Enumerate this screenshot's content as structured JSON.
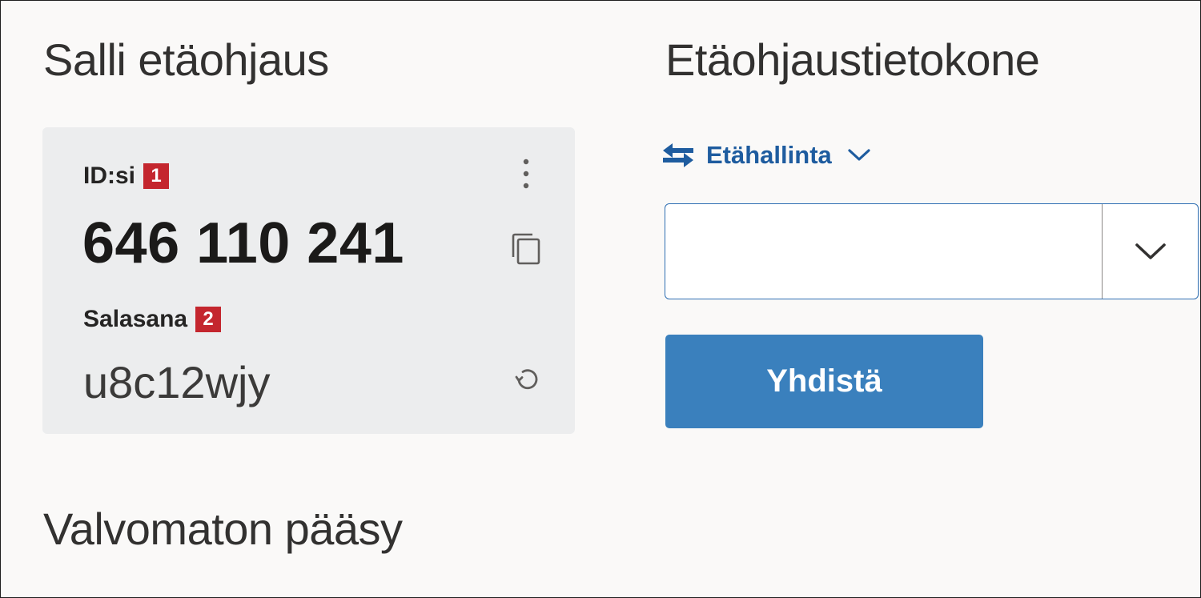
{
  "allow_section": {
    "title": "Salli etäohjaus",
    "id_label": "ID:si",
    "id_badge": "1",
    "id_value": "646 110 241",
    "password_label": "Salasana",
    "password_badge": "2",
    "password_value": "u8c12wjy",
    "more_icon": "more-vertical-icon",
    "copy_icon": "copy-icon",
    "refresh_icon": "refresh-icon"
  },
  "remote_section": {
    "title": "Etäohjaustietokone",
    "mode_label": "Etähallinta",
    "mode_icon": "swap-arrows-icon",
    "partner_id_value": "",
    "connect_label": "Yhdistä"
  },
  "unattended_section": {
    "title": "Valvomaton pääsy"
  },
  "colors": {
    "badge": "#c4262e",
    "accent": "#1e5c9f",
    "button": "#3a80bd",
    "card": "#ecedee",
    "background": "#faf9f8"
  }
}
